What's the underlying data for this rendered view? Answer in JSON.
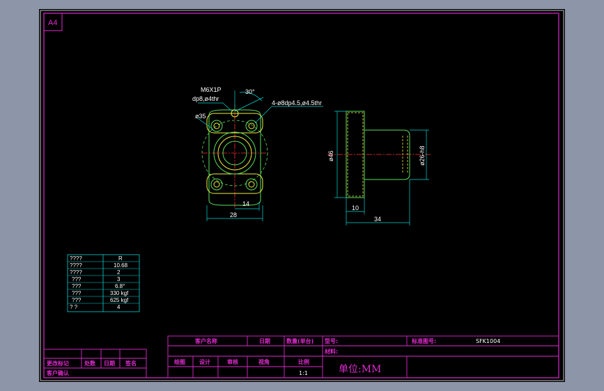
{
  "sheet": {
    "size_label": "A4"
  },
  "front_view": {
    "thread_note_line1": "M6X1P",
    "thread_note_line2": "dp8,ø4thr",
    "angle_label": "30°",
    "holes_note": "4-ø8dp4.5,ø4.5thr",
    "diameter_label": "ø35",
    "dim_inner": "14",
    "dim_width": "28"
  },
  "side_view": {
    "dim_diameter": "ø46",
    "dim_bore": "ø26-h8",
    "dim_flange": "10",
    "dim_length": "34"
  },
  "spec_table": {
    "rows": [
      {
        "label": "????",
        "value": "R"
      },
      {
        "label": "????",
        "value": "10.68"
      },
      {
        "label": "????",
        "value": "2"
      },
      {
        "label": "???",
        "value": "3"
      },
      {
        "label": "???",
        "value": "6.8°"
      },
      {
        "label": "???",
        "value": "330 kgf"
      },
      {
        "label": "???",
        "value": "625 kgf"
      },
      {
        "label": "?    ?",
        "value": "4"
      }
    ]
  },
  "title_block": {
    "customer_name": "客户名称",
    "date": "日期",
    "quantity": "数量(单台)",
    "model_label": "型号:",
    "standard_drawing_label": "标准图号:",
    "drawing_number": "SFK1004",
    "material_label": "材料:",
    "drawn": "绘图",
    "design": "设计",
    "check": "审核",
    "view_angle": "视角",
    "scale": "比例",
    "scale_value": "1:1",
    "unit": "单位:MM"
  },
  "revision_block": {
    "change_mark": "更改标记",
    "location": "处数",
    "date": "日期",
    "signature": "签名",
    "customer_confirm": "客户确认"
  }
}
